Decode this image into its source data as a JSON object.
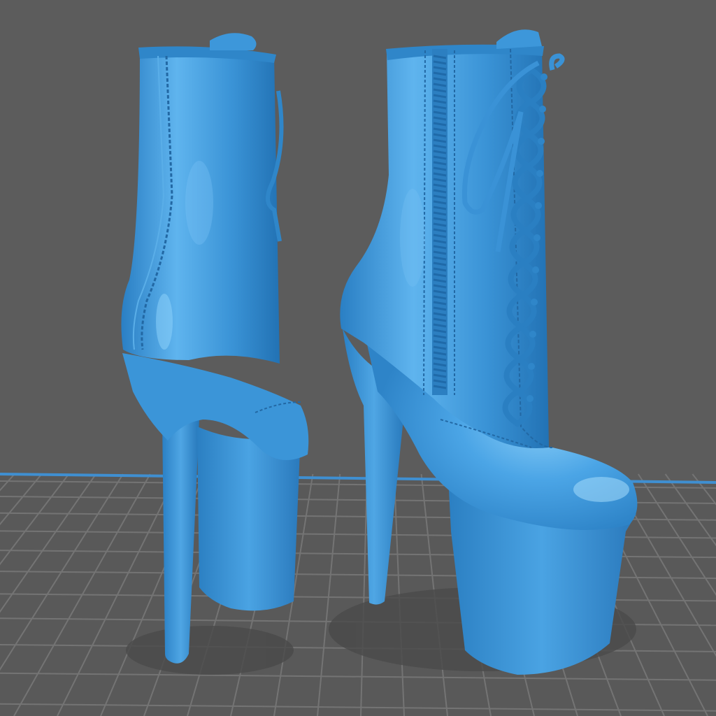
{
  "viewport": {
    "background_color": "#5c5c5c",
    "build_plate": {
      "fill_color": "#5a5a5a",
      "grid_color": "#727272",
      "edge_color": "#3f8fd1"
    }
  },
  "model": {
    "color": "#3a93d6",
    "highlight_color": "#7cc4f5",
    "shadow_color": "#1f6fae",
    "objects": [
      {
        "kind": "boot",
        "view": "rear"
      },
      {
        "kind": "boot",
        "view": "side"
      }
    ]
  }
}
